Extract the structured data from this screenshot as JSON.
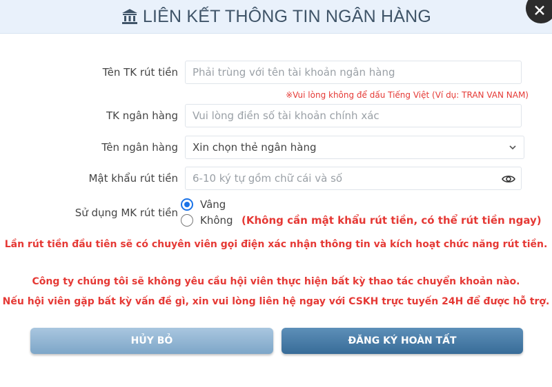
{
  "header": {
    "title": "LIÊN KẾT THÔNG TIN NGÂN HÀNG",
    "icon": "bank-icon"
  },
  "form": {
    "account_name": {
      "label": "Tên TK rút tiền",
      "placeholder": "Phải trùng với tên tài khoản ngân hàng",
      "note": "※Vui lòng không để dấu Tiếng Việt (Ví dụ: TRAN VAN NAM)"
    },
    "bank_account": {
      "label": "TK ngân hàng",
      "placeholder": "Vui lòng điền số tài khoản chính xác"
    },
    "bank_name": {
      "label": "Tên ngân hàng",
      "selected": "Xin chọn thẻ ngân hàng"
    },
    "withdraw_password": {
      "label": "Mật khẩu rút tiền",
      "placeholder": "6-10 ký tự gồm chữ cái và số"
    },
    "use_password": {
      "label": "Sử dụng MK rút tiền",
      "options": [
        "Vâng",
        "Không"
      ],
      "selected": "Vâng",
      "no_note": "(Không cần mật khẩu rút tiền, có thể rút tiền ngay)"
    }
  },
  "warnings": {
    "line1": "Lần rút tiền đầu tiên sẽ có chuyên viên gọi điện xác nhận thông tin và kích hoạt chức năng rút tiền.",
    "line2": "Công ty chúng tôi sẽ không yêu cầu hội viên thực hiện bất kỳ thao tác chuyển khoản nào.",
    "line3": "Nếu hội viên gặp bất kỳ vấn đề gì, xin vui lòng liên hệ ngay với CSKH trực tuyến 24H để được hỗ trợ."
  },
  "buttons": {
    "cancel": "HỦY BỎ",
    "submit": "ĐĂNG KÝ HOÀN TẤT"
  },
  "colors": {
    "warning_red": "#e53935",
    "title": "#3f5468",
    "submit_button": "#386c98",
    "cancel_button": "#7da6c8"
  }
}
